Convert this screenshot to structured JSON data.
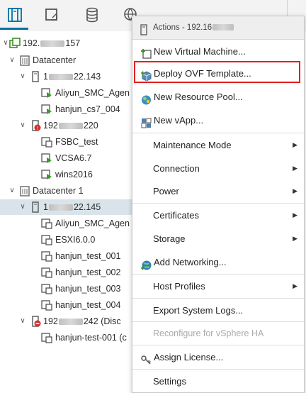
{
  "toolbar": {
    "icons": [
      "hosts-clusters-icon",
      "vms-templates-icon",
      "storage-icon",
      "networking-icon"
    ],
    "accent": "#0072a3"
  },
  "tree": {
    "root": {
      "label_pre": "192.",
      "label_post": "157"
    },
    "datacenter1": {
      "label": "Datacenter"
    },
    "host1": {
      "label_pre": "1",
      "label_post": "22.143"
    },
    "vms1": [
      "Aliyun_SMC_Agen",
      "hanjun_cs7_004"
    ],
    "host2": {
      "label_pre": "192",
      "label_post": "220"
    },
    "vms2": [
      "FSBC_test",
      "VCSA6.7",
      "wins2016"
    ],
    "datacenter2": {
      "label": "Datacenter 1"
    },
    "host3": {
      "label_pre": "1",
      "label_post": "22.145"
    },
    "vms3": [
      "Aliyun_SMC_Agen",
      "ESXI6.0.0",
      "hanjun_test_001",
      "hanjun_test_002",
      "hanjun_test_003",
      "hanjun_test_004"
    ],
    "host4": {
      "label_pre": "192",
      "label_post": "242 (Disc"
    },
    "vms4": [
      "hanjun-test-001 (c"
    ]
  },
  "menu": {
    "header": "Actions - 192.16",
    "items": [
      {
        "label": "New Virtual Machine...",
        "icon": "new-vm-icon",
        "enabled": true
      },
      {
        "label": "Deploy OVF Template...",
        "icon": "deploy-ovf-icon",
        "enabled": true
      },
      {
        "label": "New Resource Pool...",
        "icon": "resource-pool-icon",
        "enabled": true
      },
      {
        "label": "New vApp...",
        "icon": "vapp-icon",
        "enabled": true
      },
      {
        "label": "Maintenance Mode",
        "submenu": true,
        "enabled": true
      },
      {
        "label": "Connection",
        "submenu": true,
        "enabled": true
      },
      {
        "label": "Power",
        "submenu": true,
        "enabled": true
      },
      {
        "label": "Certificates",
        "submenu": true,
        "enabled": true
      },
      {
        "label": "Storage",
        "submenu": true,
        "enabled": true
      },
      {
        "label": "Add Networking...",
        "icon": "add-networking-icon",
        "enabled": true
      },
      {
        "label": "Host Profiles",
        "submenu": true,
        "enabled": true
      },
      {
        "label": "Export System Logs...",
        "enabled": true
      },
      {
        "label": "Reconfigure for vSphere HA",
        "enabled": false
      },
      {
        "label": "Assign License...",
        "icon": "license-icon",
        "enabled": true
      },
      {
        "label": "Settings",
        "enabled": true
      }
    ],
    "highlight_color": "#e02020"
  }
}
